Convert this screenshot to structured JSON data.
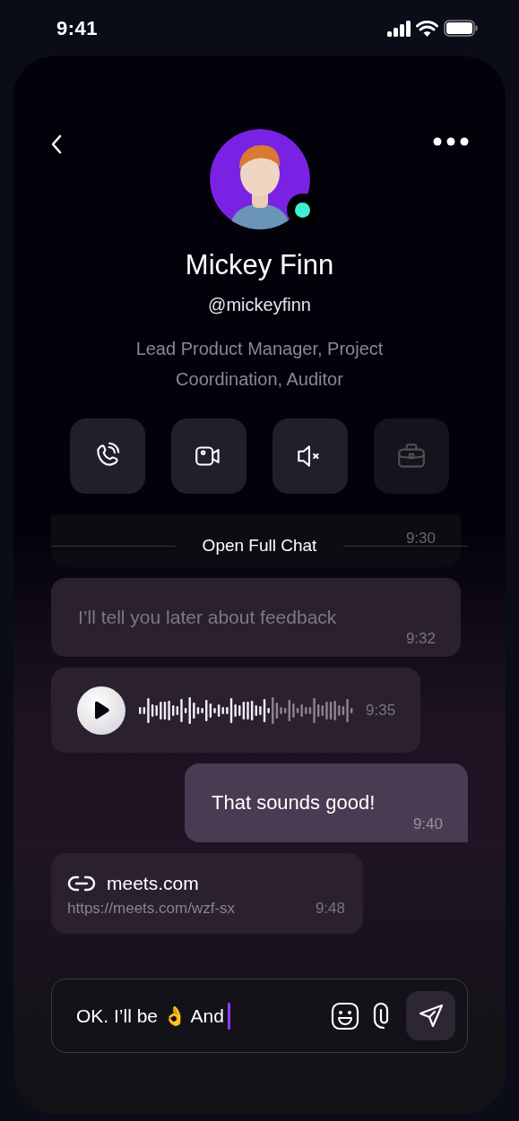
{
  "status_bar": {
    "time": "9:41"
  },
  "profile": {
    "name": "Mickey Finn",
    "handle": "@mickeyfinn",
    "role": "Lead Product Manager, Project Coordination, Auditor",
    "online": true
  },
  "actions": [
    {
      "kind": "call",
      "disabled": false
    },
    {
      "kind": "video",
      "disabled": false
    },
    {
      "kind": "mute",
      "disabled": false
    },
    {
      "kind": "briefcase",
      "disabled": true
    }
  ],
  "divider": {
    "label": "Open Full Chat"
  },
  "messages": [
    {
      "kind": "partial",
      "outgoing": false,
      "time": "9:30"
    },
    {
      "kind": "text",
      "outgoing": false,
      "text": "I’ll tell you later about feedback",
      "time": "9:32"
    },
    {
      "kind": "voice",
      "outgoing": false,
      "time": "9:35"
    },
    {
      "kind": "text",
      "outgoing": true,
      "text": "That sounds good!",
      "time": "9:40"
    },
    {
      "kind": "link",
      "outgoing": false,
      "title": "meets.com",
      "url": "https://meets.com/wzf-sx",
      "time": "9:48"
    }
  ],
  "composer": {
    "value": "OK. I’ll be 👌 And"
  }
}
